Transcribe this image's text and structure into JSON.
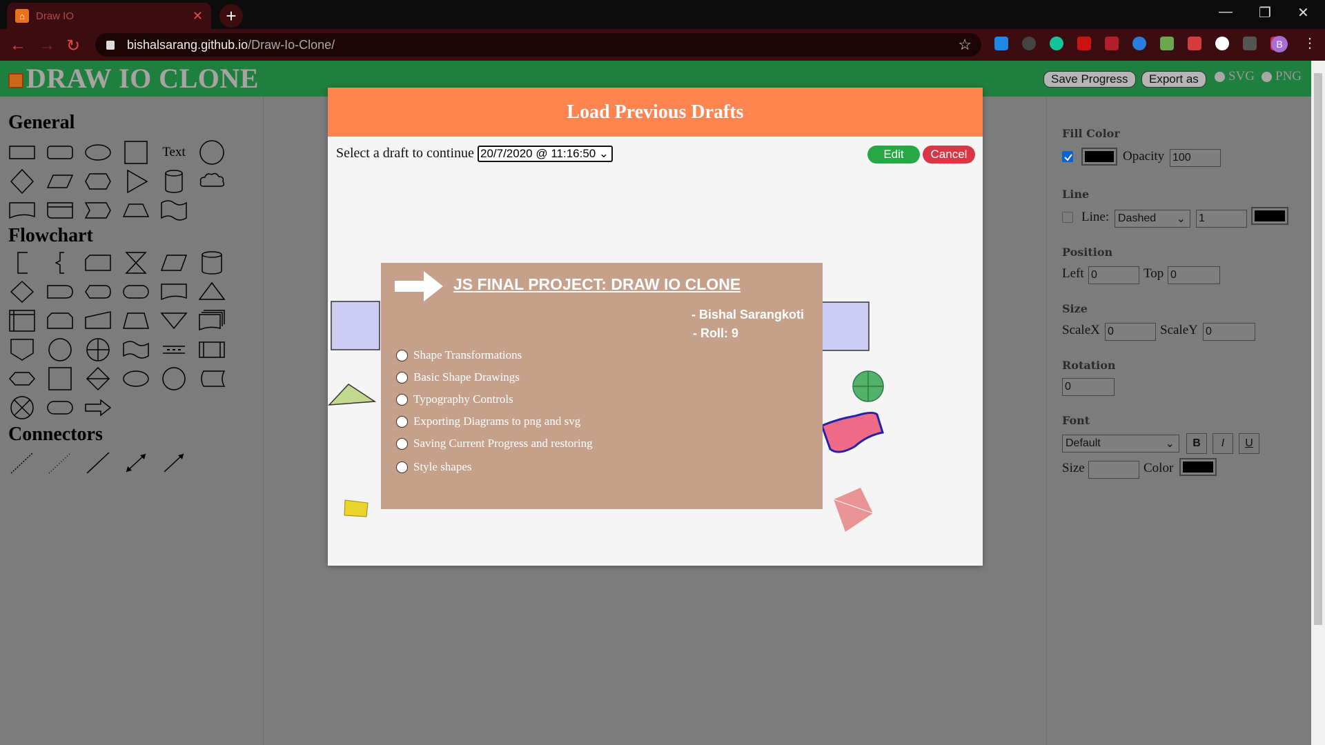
{
  "browser": {
    "tab_title": "Draw IO",
    "url_host": "bishalsarang.github.io",
    "url_path": "/Draw-Io-Clone/",
    "profile_initial": "B"
  },
  "app": {
    "title": "DRAW IO CLONE",
    "save_button": "Save Progress",
    "export_button": "Export as",
    "export_svg": "SVG",
    "export_png": "PNG"
  },
  "left_panel": {
    "general": "General",
    "text_label": "Text",
    "flowchart": "Flowchart",
    "connectors": "Connectors"
  },
  "right_panel": {
    "fill_color": "Fill Color",
    "opacity_label": "Opacity",
    "opacity_value": "100",
    "line_heading": "Line",
    "line_label": "Line:",
    "line_style": "Dashed",
    "line_width": "1",
    "position_heading": "Position",
    "left_label": "Left",
    "left_value": "0",
    "top_label": "Top",
    "top_value": "0",
    "size_heading": "Size",
    "scalex_label": "ScaleX",
    "scalex_value": "0",
    "scaley_label": "ScaleY",
    "scaley_value": "0",
    "rotation_heading": "Rotation",
    "rotation_value": "0",
    "font_heading": "Font",
    "font_family": "Default",
    "bold": "B",
    "italic": "I",
    "underline": "U",
    "font_size_label": "Size",
    "font_size_value": "",
    "color_label": "Color"
  },
  "modal": {
    "title": "Load Previous Drafts",
    "select_label": "Select a draft to continue",
    "selected_draft": "20/7/2020 @ 11:16:50",
    "edit": "Edit",
    "cancel": "Cancel",
    "preview": {
      "title": "JS FINAL PROJECT: DRAW IO CLONE",
      "author": "- Bishal Sarangkoti",
      "roll": "- Roll: 9",
      "features": [
        "Shape Transformations",
        "Basic Shape Drawings",
        "Typography Controls",
        "Exporting Diagrams to png and svg",
        "Saving Current Progress and restoring",
        "Style shapes"
      ]
    }
  },
  "colors": {
    "app_bar": "#1f7f3e",
    "modal_header": "#ff8450",
    "edit": "#28a745",
    "cancel": "#dc3545",
    "preview_bg": "#c5a18b"
  }
}
